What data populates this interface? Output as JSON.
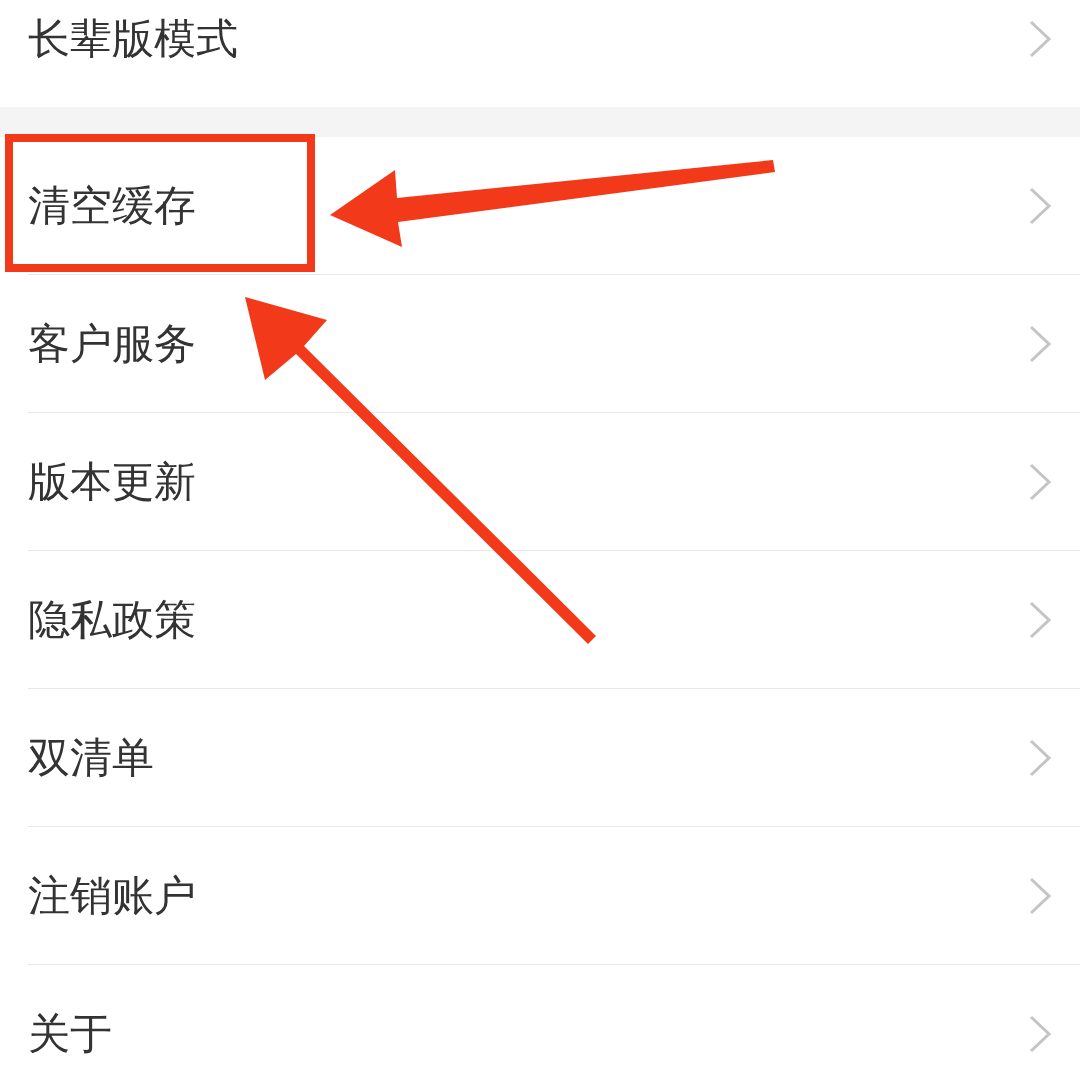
{
  "sections": [
    {
      "items": [
        {
          "label": "长辈版模式",
          "highlighted": false
        }
      ]
    },
    {
      "items": [
        {
          "label": "清空缓存",
          "highlighted": true
        },
        {
          "label": "客户服务",
          "highlighted": false
        },
        {
          "label": "版本更新",
          "highlighted": false
        },
        {
          "label": "隐私政策",
          "highlighted": false
        },
        {
          "label": "双清单",
          "highlighted": false
        },
        {
          "label": "注销账户",
          "highlighted": false
        },
        {
          "label": "关于",
          "highlighted": false
        }
      ]
    }
  ]
}
